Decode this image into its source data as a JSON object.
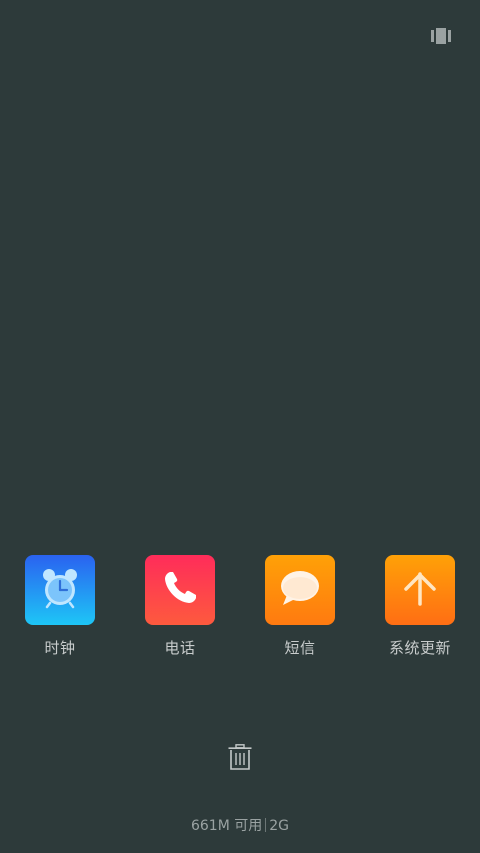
{
  "top_right": {
    "icon": "view-toggle-icon"
  },
  "apps": [
    {
      "label": "时钟",
      "icon": "alarm-clock-icon",
      "color_top": "#2a62f0",
      "color_bottom": "#1ec6f6"
    },
    {
      "label": "电话",
      "icon": "phone-icon",
      "color_top": "#ff2c5a",
      "color_bottom": "#fd5a3e"
    },
    {
      "label": "短信",
      "icon": "message-bubble-icon",
      "color_top": "#ffa107",
      "color_bottom": "#ff7a10"
    },
    {
      "label": "系统更新",
      "icon": "arrow-up-icon",
      "color_top": "#ffa107",
      "color_bottom": "#ff6e14"
    }
  ],
  "bottom": {
    "trash_icon": "trash-icon",
    "memory_available": "661M 可用",
    "memory_total": "2G"
  }
}
